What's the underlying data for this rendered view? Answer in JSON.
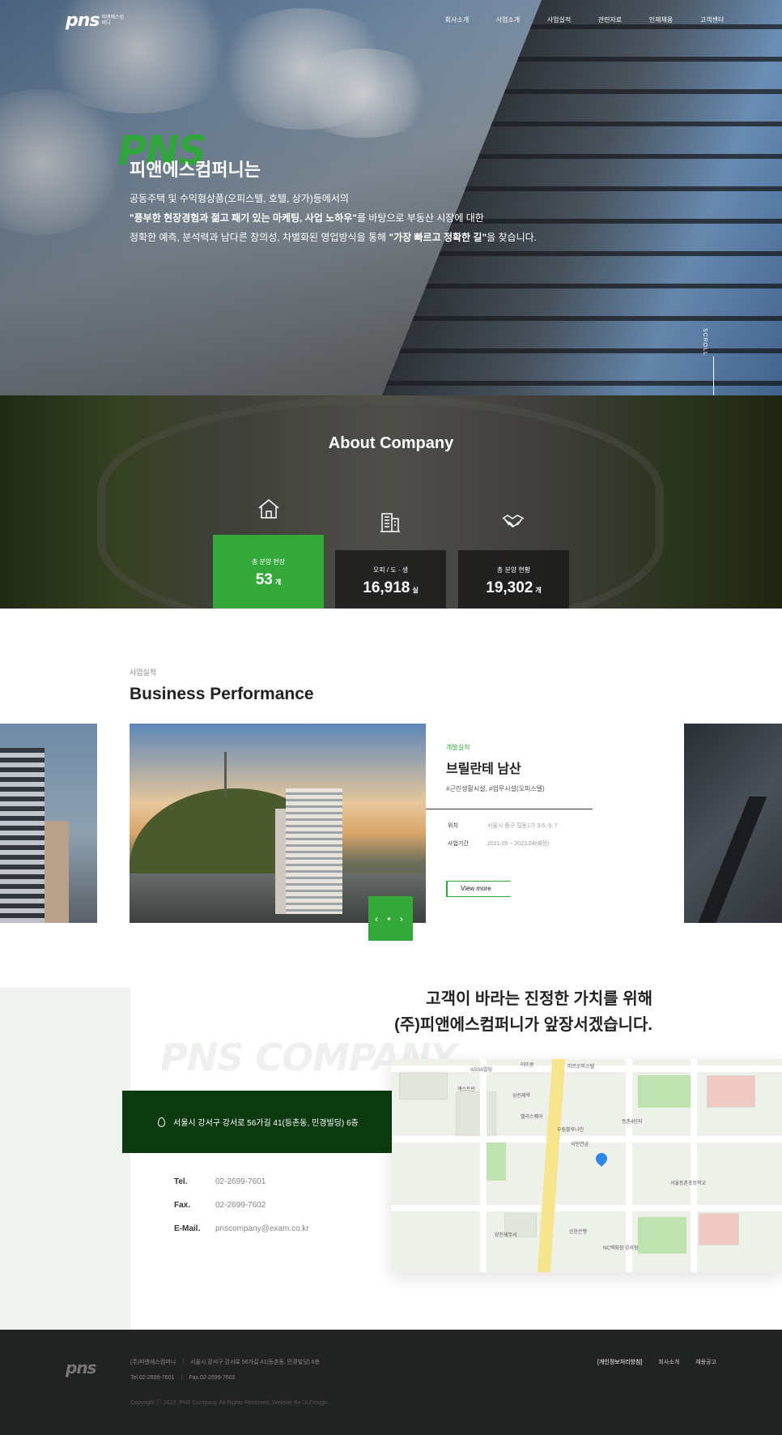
{
  "header": {
    "logo_text": "pns",
    "logo_sub": "피앤에스컴퍼니",
    "nav": [
      "회사소개",
      "사업소개",
      "사업실적",
      "관련자료",
      "인재채용",
      "고객센터"
    ]
  },
  "hero": {
    "brand": "PNS",
    "title": "피앤에스컴퍼니는",
    "line1": "공동주택 및 수익형상품(오피스텔, 호텔, 상가)등에서의",
    "line2_bold": "\"풍부한 현장경험과 젊고 패기 있는 마케팅, 사업 노하우\"",
    "line2_rest": "를 바탕으로 부동산 시장에 대한",
    "line3_pre": "정확한 예측, 분석력과 남다른 창의성, 차별화된 영업방식을 통해 ",
    "line3_bold": "\"가장 빠르고 정확한 길\"",
    "line3_post": "을 찾습니다.",
    "scroll": "SCROLL"
  },
  "about": {
    "title": "About Company",
    "stats": [
      {
        "label": "총 분양 현장",
        "value": "53",
        "unit": "개",
        "icon": "house-icon"
      },
      {
        "label": "오피 / 도 · 생",
        "value": "16,918",
        "unit": "실",
        "icon": "building-icon"
      },
      {
        "label": "총 분양 현황",
        "value": "19,302",
        "unit": "개",
        "icon": "handshake-icon"
      }
    ]
  },
  "business": {
    "kicker": "사업실적",
    "title": "Business Performance",
    "project": {
      "category": "개발실적",
      "name": "브릴란테 남산",
      "tags": "#근린생활시설, #업무시설(오피스텔)",
      "location_label": "위치",
      "location": "서울시 중구 힐동1가 3-5, 6, 7",
      "period_label": "사업기간",
      "period": "2021.05 ~ 2023.04(예정)",
      "view_more": "View more"
    },
    "control": "‹ • ›"
  },
  "contact": {
    "headline1": "고객이 바라는 진정한 가치를 위해",
    "headline2": "(주)피앤에스컴퍼니가 앞장서겠습니다.",
    "watermark": "PNS COMPANY",
    "address": "서울시 강서구 강서로 56가길 41(등촌동, 민경빌딩) 6층",
    "tel_label": "Tel.",
    "tel": "02-2699-7601",
    "fax_label": "Fax.",
    "fax": "02-2699-7602",
    "email_label": "E-Mail.",
    "email": "pnscompany@exam.co.kr"
  },
  "map": {
    "labels": [
      "ASSA빌딩",
      "아뜨몽",
      "미르오피스텔",
      "캐스트빈",
      "삼진제약",
      "밸리스퀘어",
      "우림블루나인",
      "국민연금",
      "등촌4단지",
      "서울등촌초등학교",
      "NC백화점 강서점",
      "신한은행",
      "양천세무서"
    ]
  },
  "footer": {
    "logo_text": "pns",
    "company": "(주)피앤에스컴퍼니",
    "address": "서울시 강서구 강서로 56가길 41(등촌동, 민경빌딩) 6층",
    "tel": "Tel.02-2699-7601",
    "fax": "Fax.02-2699-7602",
    "copyright": "Copyright ⓒ 2022. PNS Company. All Rights Reserved. Website By ULDesign.",
    "links": [
      "[개인정보처리방침]",
      "회사소개",
      "채용공고"
    ]
  }
}
